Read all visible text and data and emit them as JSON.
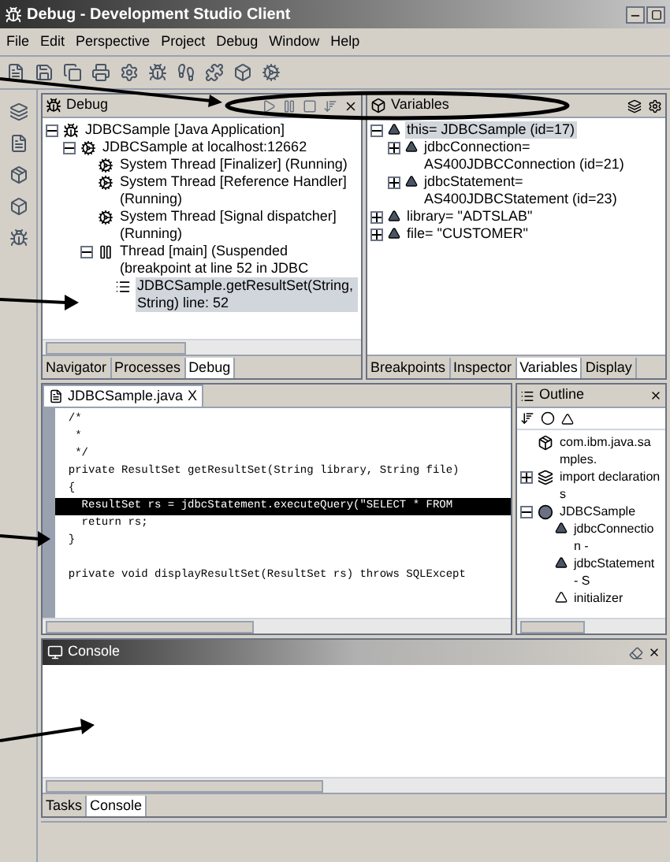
{
  "window": {
    "title": "Debug - Development Studio Client"
  },
  "menu": [
    "File",
    "Edit",
    "Perspective",
    "Project",
    "Debug",
    "Window",
    "Help"
  ],
  "debug_view": {
    "title": "Debug",
    "tree": [
      {
        "label": "JDBCSample [Java Application]",
        "kind": "app",
        "expanded": true,
        "selected": false,
        "children": [
          {
            "label": "JDBCSample at localhost:12662",
            "kind": "target",
            "expanded": true,
            "selected": false,
            "children": [
              {
                "label": "System Thread [Finalizer] (Running)",
                "kind": "thread",
                "selected": false
              },
              {
                "label": "System Thread [Reference Handler] (Running)",
                "kind": "thread",
                "selected": false
              },
              {
                "label": "System Thread [Signal dispatcher] (Running)",
                "kind": "thread",
                "selected": false
              },
              {
                "label": "Thread [main] (Suspended (breakpoint at line 52 in JDBC",
                "kind": "suspended",
                "expanded": true,
                "selected": false,
                "children": [
                  {
                    "label": "JDBCSample.getResultSet(String, String) line: 52",
                    "kind": "frame",
                    "selected": true
                  }
                ]
              }
            ]
          }
        ]
      }
    ],
    "tabs": [
      {
        "label": "Navigator",
        "selected": false
      },
      {
        "label": "Processes",
        "selected": false
      },
      {
        "label": "Debug",
        "selected": true
      }
    ]
  },
  "variables_view": {
    "title": "Variables",
    "tree": [
      {
        "label": "this= JDBCSample (id=17)",
        "kind": "field",
        "expanded": true,
        "selected": true,
        "children": [
          {
            "label": "jdbcConnection= AS400JDBCConnection (id=21)",
            "kind": "field",
            "expanded": false,
            "selected": false
          },
          {
            "label": "jdbcStatement= AS400JDBCStatement (id=23)",
            "kind": "field",
            "expanded": false,
            "selected": false
          }
        ]
      },
      {
        "label": "library= \"ADTSLAB\"",
        "kind": "field",
        "expanded": false,
        "selected": false
      },
      {
        "label": "file= \"CUSTOMER\"",
        "kind": "field",
        "expanded": false,
        "selected": false
      }
    ],
    "tabs": [
      {
        "label": "Breakpoints",
        "selected": false
      },
      {
        "label": "Inspector",
        "selected": false
      },
      {
        "label": "Variables",
        "selected": true
      },
      {
        "label": "Display",
        "selected": false
      }
    ]
  },
  "editor": {
    "tab": "JDBCSample.java",
    "tab_close": "X",
    "lines": [
      {
        "kind": "code",
        "text": "  /*",
        "current": false
      },
      {
        "kind": "code",
        "text": "   *",
        "current": false
      },
      {
        "kind": "code",
        "text": "   */",
        "current": false
      },
      {
        "kind": "code",
        "text": "  private ResultSet getResultSet(String library, String file)",
        "current": false
      },
      {
        "kind": "code",
        "text": "  {",
        "current": false
      },
      {
        "kind": "code",
        "text": "    ResultSet rs = jdbcStatement.executeQuery(\"SELECT * FROM",
        "current": true
      },
      {
        "kind": "code",
        "text": "    return rs;",
        "current": false
      },
      {
        "kind": "code",
        "text": "  }",
        "current": false
      },
      {
        "kind": "blank"
      },
      {
        "kind": "code",
        "text": "  private void displayResultSet(ResultSet rs) throws SQLExcept",
        "current": false
      }
    ]
  },
  "outline": {
    "title": "Outline",
    "tree": [
      {
        "label": "com.ibm.java.samples.",
        "kind": "package",
        "selected": false
      },
      {
        "label": "import declarations",
        "kind": "imports",
        "expanded": false,
        "selected": false
      },
      {
        "label": "JDBCSample",
        "kind": "class",
        "expanded": true,
        "selected": false,
        "children": [
          {
            "label": "jdbcConnection -",
            "kind": "field",
            "selected": false
          },
          {
            "label": "jdbcStatement - S",
            "kind": "field",
            "selected": false
          },
          {
            "label": "initializer",
            "kind": "initializer",
            "selected": false
          }
        ]
      }
    ]
  },
  "console": {
    "title": "Console",
    "tabs": [
      {
        "label": "Tasks",
        "selected": false
      },
      {
        "label": "Console",
        "selected": true
      }
    ]
  }
}
